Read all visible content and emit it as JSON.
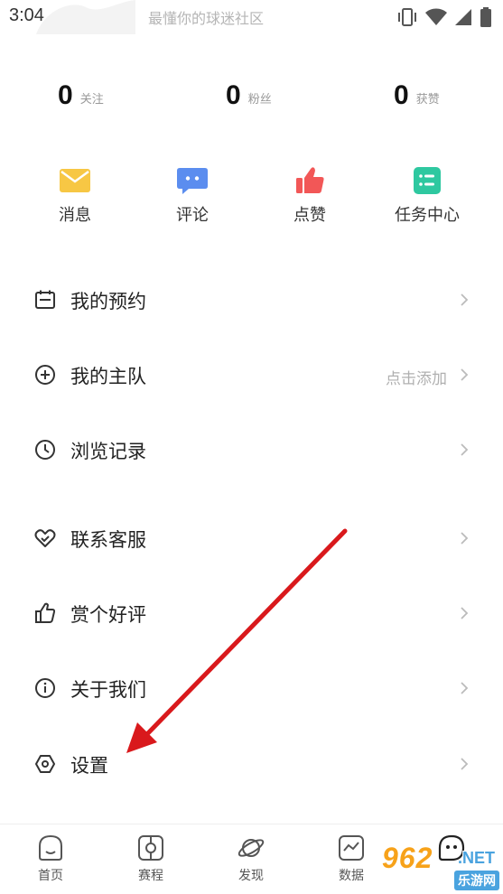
{
  "status_bar": {
    "time": "3:04",
    "slogan": "最懂你的球迷社区"
  },
  "stats": [
    {
      "count": "0",
      "label": "关注"
    },
    {
      "count": "0",
      "label": "粉丝"
    },
    {
      "count": "0",
      "label": "获赞"
    }
  ],
  "quick_actions": [
    {
      "label": "消息",
      "icon": "envelope-icon",
      "color": "#f7c744"
    },
    {
      "label": "评论",
      "icon": "chat-bubble-icon",
      "color": "#5b8def"
    },
    {
      "label": "点赞",
      "icon": "thumbs-up-icon",
      "color": "#f25757"
    },
    {
      "label": "任务中心",
      "icon": "task-list-icon",
      "color": "#2ec8a0"
    }
  ],
  "menu": [
    {
      "label": "我的预约",
      "hint": "",
      "icon": "calendar-icon"
    },
    {
      "label": "我的主队",
      "hint": "点击添加",
      "icon": "plus-circle-icon"
    },
    {
      "label": "浏览记录",
      "hint": "",
      "icon": "clock-icon"
    },
    {
      "label": "联系客服",
      "hint": "",
      "icon": "heart-handshake-icon"
    },
    {
      "label": "赏个好评",
      "hint": "",
      "icon": "thumbs-up-outline-icon"
    },
    {
      "label": "关于我们",
      "hint": "",
      "icon": "info-circle-icon"
    },
    {
      "label": "设置",
      "hint": "",
      "icon": "settings-hexagon-icon"
    }
  ],
  "bottom_nav": [
    {
      "label": "首页",
      "icon": "home-icon"
    },
    {
      "label": "赛程",
      "icon": "schedule-icon"
    },
    {
      "label": "发现",
      "icon": "planet-icon"
    },
    {
      "label": "数据",
      "icon": "chart-icon"
    },
    {
      "label": "",
      "icon": "profile-face-icon"
    }
  ],
  "watermark": {
    "number": "962",
    "suffix": ".NET",
    "site": "乐游网"
  },
  "colors": {
    "annotation_arrow": "#d9191c"
  }
}
